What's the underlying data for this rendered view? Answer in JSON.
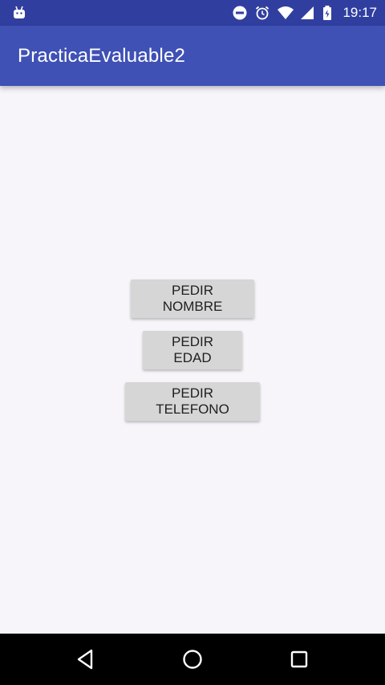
{
  "status_bar": {
    "time": "19:17",
    "icons": [
      "android-debug-icon",
      "do-not-disturb-icon",
      "alarm-icon",
      "wifi-icon",
      "signal-icon",
      "battery-icon"
    ]
  },
  "app_bar": {
    "title": "PracticaEvaluable2",
    "color": "#3f51b5",
    "status_color": "#303f9f"
  },
  "buttons": {
    "pedir_nombre": "PEDIR NOMBRE",
    "pedir_edad": "PEDIR EDAD",
    "pedir_telefono": "PEDIR TELEFONO"
  },
  "nav_bar": {
    "icons": [
      "back-icon",
      "home-icon",
      "recent-apps-icon"
    ]
  }
}
